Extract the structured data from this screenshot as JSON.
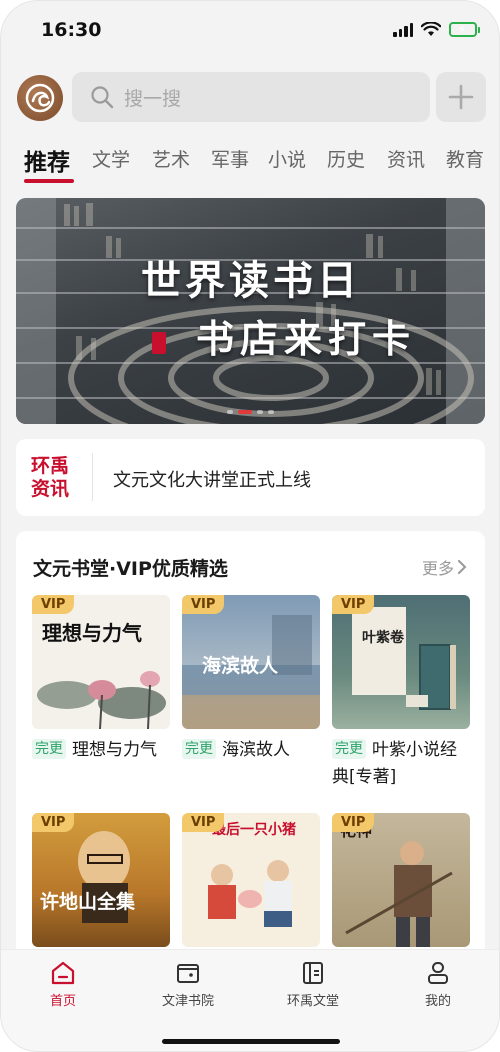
{
  "status_bar": {
    "time": "16:30"
  },
  "header": {
    "search_placeholder": "搜一搜"
  },
  "tabs": [
    {
      "label": "推荐",
      "active": true
    },
    {
      "label": "文学"
    },
    {
      "label": "艺术"
    },
    {
      "label": "军事"
    },
    {
      "label": "小说"
    },
    {
      "label": "历史"
    },
    {
      "label": "资讯"
    },
    {
      "label": "教育"
    }
  ],
  "banner": {
    "title_line1": "世界读书日",
    "title_line2": "书店来打卡"
  },
  "news": {
    "brand": "环禹资讯",
    "headline": "文元文化大讲堂正式上线"
  },
  "vip_section": {
    "title": "文元书堂·VIP优质精选",
    "more_label": "更多",
    "badge_label": "VIP",
    "books": [
      {
        "status": "完更",
        "title": "理想与力气",
        "cover_text": "理想与力气"
      },
      {
        "status": "完更",
        "title": "海滨故人",
        "cover_text": "海滨故人"
      },
      {
        "status": "完更",
        "title": "叶紫小说经典[专著]",
        "cover_text": "叶紫卷"
      },
      {
        "status": "",
        "title": "",
        "cover_text": "许地山全集"
      },
      {
        "status": "",
        "title": "",
        "cover_text": "最后一只小猪"
      },
      {
        "status": "",
        "title": "",
        "cover_text": "花神"
      }
    ]
  },
  "bottom_nav": [
    {
      "label": "首页",
      "icon": "home-icon",
      "active": true
    },
    {
      "label": "文津书院",
      "icon": "wallet-icon"
    },
    {
      "label": "环禹文堂",
      "icon": "book-icon"
    },
    {
      "label": "我的",
      "icon": "user-icon"
    }
  ],
  "colors": {
    "accent": "#c8102e",
    "vip_badge": "#f3c86a",
    "status_green": "#2fa36b"
  }
}
